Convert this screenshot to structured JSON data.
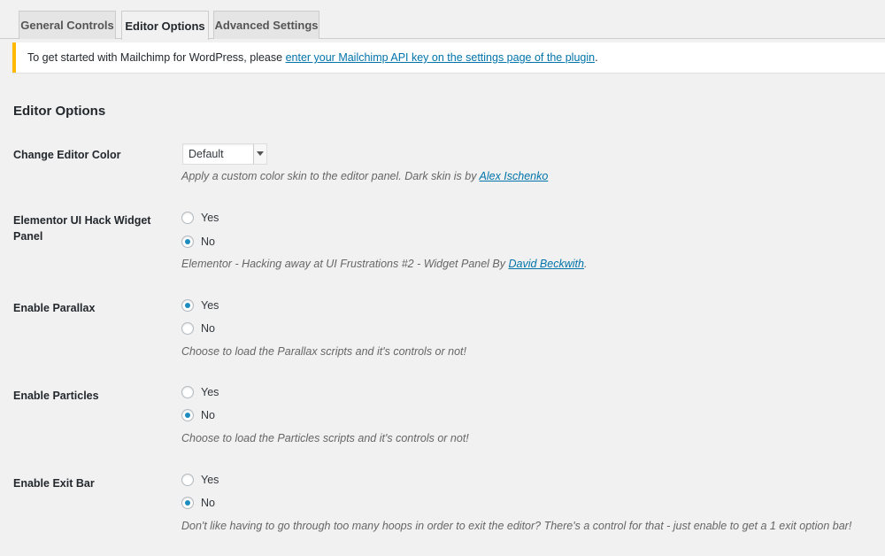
{
  "tabs": [
    {
      "label": "General Controls"
    },
    {
      "label": "Editor Options"
    },
    {
      "label": "Advanced Settings"
    }
  ],
  "notice": {
    "text_before": "To get started with Mailchimp for WordPress, please ",
    "link_text": "enter your Mailchimp API key on the settings page of the plugin",
    "text_after": "."
  },
  "section_title": "Editor Options",
  "change_editor_color": {
    "label": "Change Editor Color",
    "selected": "Default",
    "desc_before": "Apply a custom color skin to the editor panel. Dark skin is by ",
    "desc_link": "Alex Ischenko"
  },
  "ui_hack": {
    "label": "Elementor UI Hack Widget Panel",
    "options": [
      "Yes",
      "No"
    ],
    "selected": "No",
    "desc_before": "Elementor - Hacking away at UI Frustrations #2 - Widget Panel By ",
    "desc_link": "David Beckwith",
    "desc_after": "."
  },
  "parallax": {
    "label": "Enable Parallax",
    "options": [
      "Yes",
      "No"
    ],
    "selected": "Yes",
    "desc": "Choose to load the Parallax scripts and it's controls or not!"
  },
  "particles": {
    "label": "Enable Particles",
    "options": [
      "Yes",
      "No"
    ],
    "selected": "No",
    "desc": "Choose to load the Particles scripts and it's controls or not!"
  },
  "exit_bar": {
    "label": "Enable Exit Bar",
    "options": [
      "Yes",
      "No"
    ],
    "selected": "No",
    "desc": "Don't like having to go through too many hoops in order to exit the editor? There's a control for that - just enable to get a 1 exit option bar!"
  },
  "colors": {
    "accent": "#0073aa",
    "radio_checked": "#1e8cbe",
    "notice_border": "#ffb900"
  },
  "icons": {
    "select_arrow": "chevron-down-icon"
  }
}
